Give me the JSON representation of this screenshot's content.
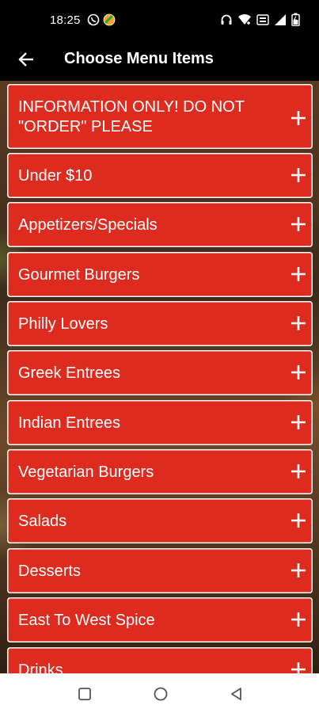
{
  "status_bar": {
    "time": "18:25",
    "left_icons": [
      "whatsapp-icon",
      "app-notification-icon"
    ],
    "right_icons": [
      "headphones-icon",
      "wifi-icon",
      "volte-icon",
      "signal-icon",
      "battery-icon"
    ]
  },
  "app_bar": {
    "title": "Choose Menu Items",
    "back_icon": "arrow-left-icon"
  },
  "menu": {
    "expand_icon": "plus-icon",
    "item_color": "#dd2b1f",
    "items": [
      {
        "label": "INFORMATION ONLY!  DO NOT\n\"ORDER\" PLEASE"
      },
      {
        "label": "Under $10"
      },
      {
        "label": "Appetizers/Specials"
      },
      {
        "label": "Gourmet Burgers"
      },
      {
        "label": "Philly Lovers"
      },
      {
        "label": "Greek Entrees"
      },
      {
        "label": "Indian Entrees"
      },
      {
        "label": "Vegetarian Burgers"
      },
      {
        "label": "Salads"
      },
      {
        "label": "Desserts"
      },
      {
        "label": "East To West Spice"
      },
      {
        "label": "Drinks"
      }
    ]
  },
  "nav_bar": {
    "buttons": [
      "recents-square-icon",
      "home-circle-icon",
      "back-triangle-icon"
    ]
  }
}
